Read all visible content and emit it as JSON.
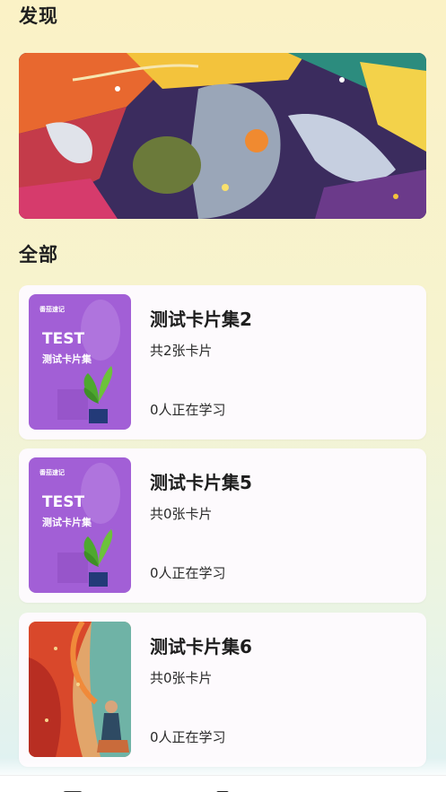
{
  "sections": {
    "discover_title": "发现",
    "all_title": "全部"
  },
  "banner": {
    "icon": "abstract-art-banner"
  },
  "card_sets": [
    {
      "name": "测试卡片集2",
      "count": "共2张卡片",
      "learners": "0人正在学习",
      "cover": {
        "type": "plant",
        "brand": "番茄速记",
        "title": "TEST",
        "subtitle": "测试卡片集"
      }
    },
    {
      "name": "测试卡片集5",
      "count": "共0张卡片",
      "learners": "0人正在学习",
      "cover": {
        "type": "plant",
        "brand": "番茄速记",
        "title": "TEST",
        "subtitle": "测试卡片集"
      }
    },
    {
      "name": "测试卡片集6",
      "count": "共0张卡片",
      "learners": "0人正在学习",
      "cover": {
        "type": "painting"
      }
    }
  ],
  "tabbar": {
    "icons": [
      "cards-tab-icon",
      "discover-tab-icon",
      "profile-tab-icon"
    ]
  },
  "colors": {
    "cover_purple": "#a25fd6",
    "background_top": "#fbf2c6",
    "background_bottom": "#def1f4"
  }
}
